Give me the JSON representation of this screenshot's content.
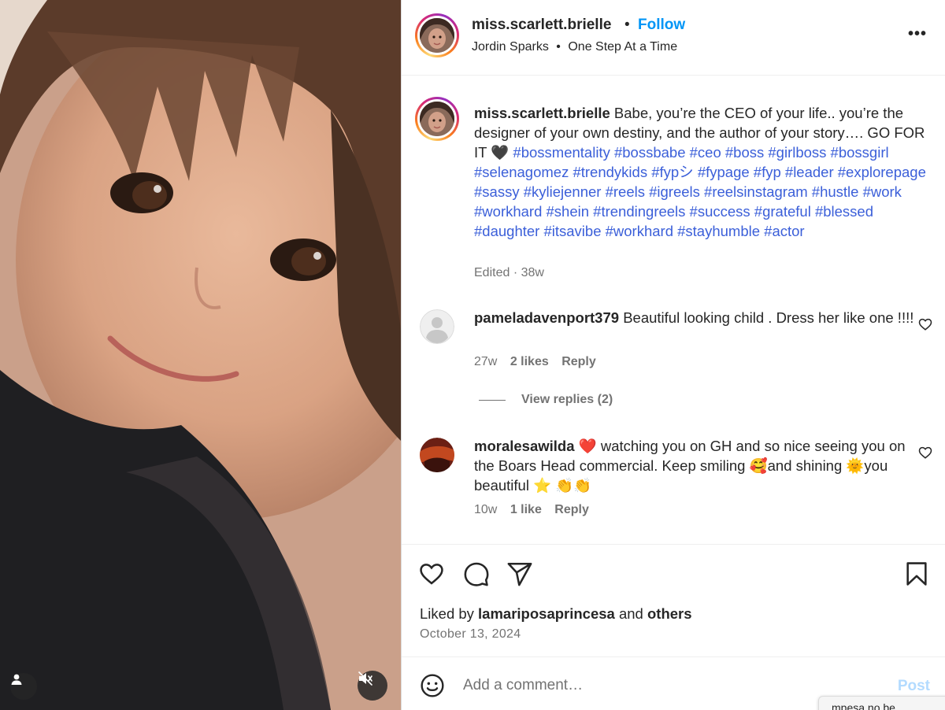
{
  "media": {
    "user_icon": "user-tag-icon",
    "mute_icon": "muted-speaker-icon"
  },
  "header": {
    "username": "miss.scarlett.brielle",
    "separator": "•",
    "follow_label": "Follow",
    "audio_artist": "Jordin Sparks",
    "audio_separator": "•",
    "audio_track": "One Step At a Time",
    "more_label": "•••"
  },
  "caption": {
    "username": "miss.scarlett.brielle",
    "text_before_tags": "Babe, you’re the CEO of your life.. you’re the designer of your own destiny, and the author of your story…. GO FOR IT 🖤",
    "hashtags": "#bossmentality #bossbabe #ceo #boss #girlboss #bossgirl #selenagomez #trendykids #fypシ #fypage #fyp #leader #explorepage #sassy #kyliejenner #reels #igreels #reelsinstagram #hustle #work #workhard #shein #trendingreels #success #grateful #blessed #daughter #itsavibe #workhard #stayhumble #actor",
    "meta": "Edited · 38w"
  },
  "comments": [
    {
      "username": "pameladavenport379",
      "text": "Beautiful looking child . Dress her like one !!!!",
      "age": "27w",
      "likes": "2 likes",
      "reply_label": "Reply",
      "view_replies": "View replies (2)"
    },
    {
      "username": "moralesawilda",
      "text": "❤️ watching you on GH and so nice seeing you on the Boars Head commercial. Keep smiling 🥰and shining 🌞you beautiful ⭐️ 👏👏",
      "age": "10w",
      "likes": "1 like",
      "reply_label": "Reply"
    }
  ],
  "actions": {
    "like_icon": "heart-icon",
    "comment_icon": "comment-icon",
    "share_icon": "share-icon",
    "save_icon": "bookmark-icon"
  },
  "likes": {
    "prefix": "Liked by",
    "user": "lamariposaprincesa",
    "conjunction": "and",
    "others": "others"
  },
  "date": "October 13, 2024",
  "add_comment": {
    "placeholder": "Add a comment…",
    "post_label": "Post",
    "tooltip_text": "mpesa  no      be"
  },
  "colors": {
    "accent_blue": "#0095f6",
    "hashtag_blue": "#3b5fd9",
    "muted_text": "#737373",
    "post_disabled": "#b3dbff"
  }
}
